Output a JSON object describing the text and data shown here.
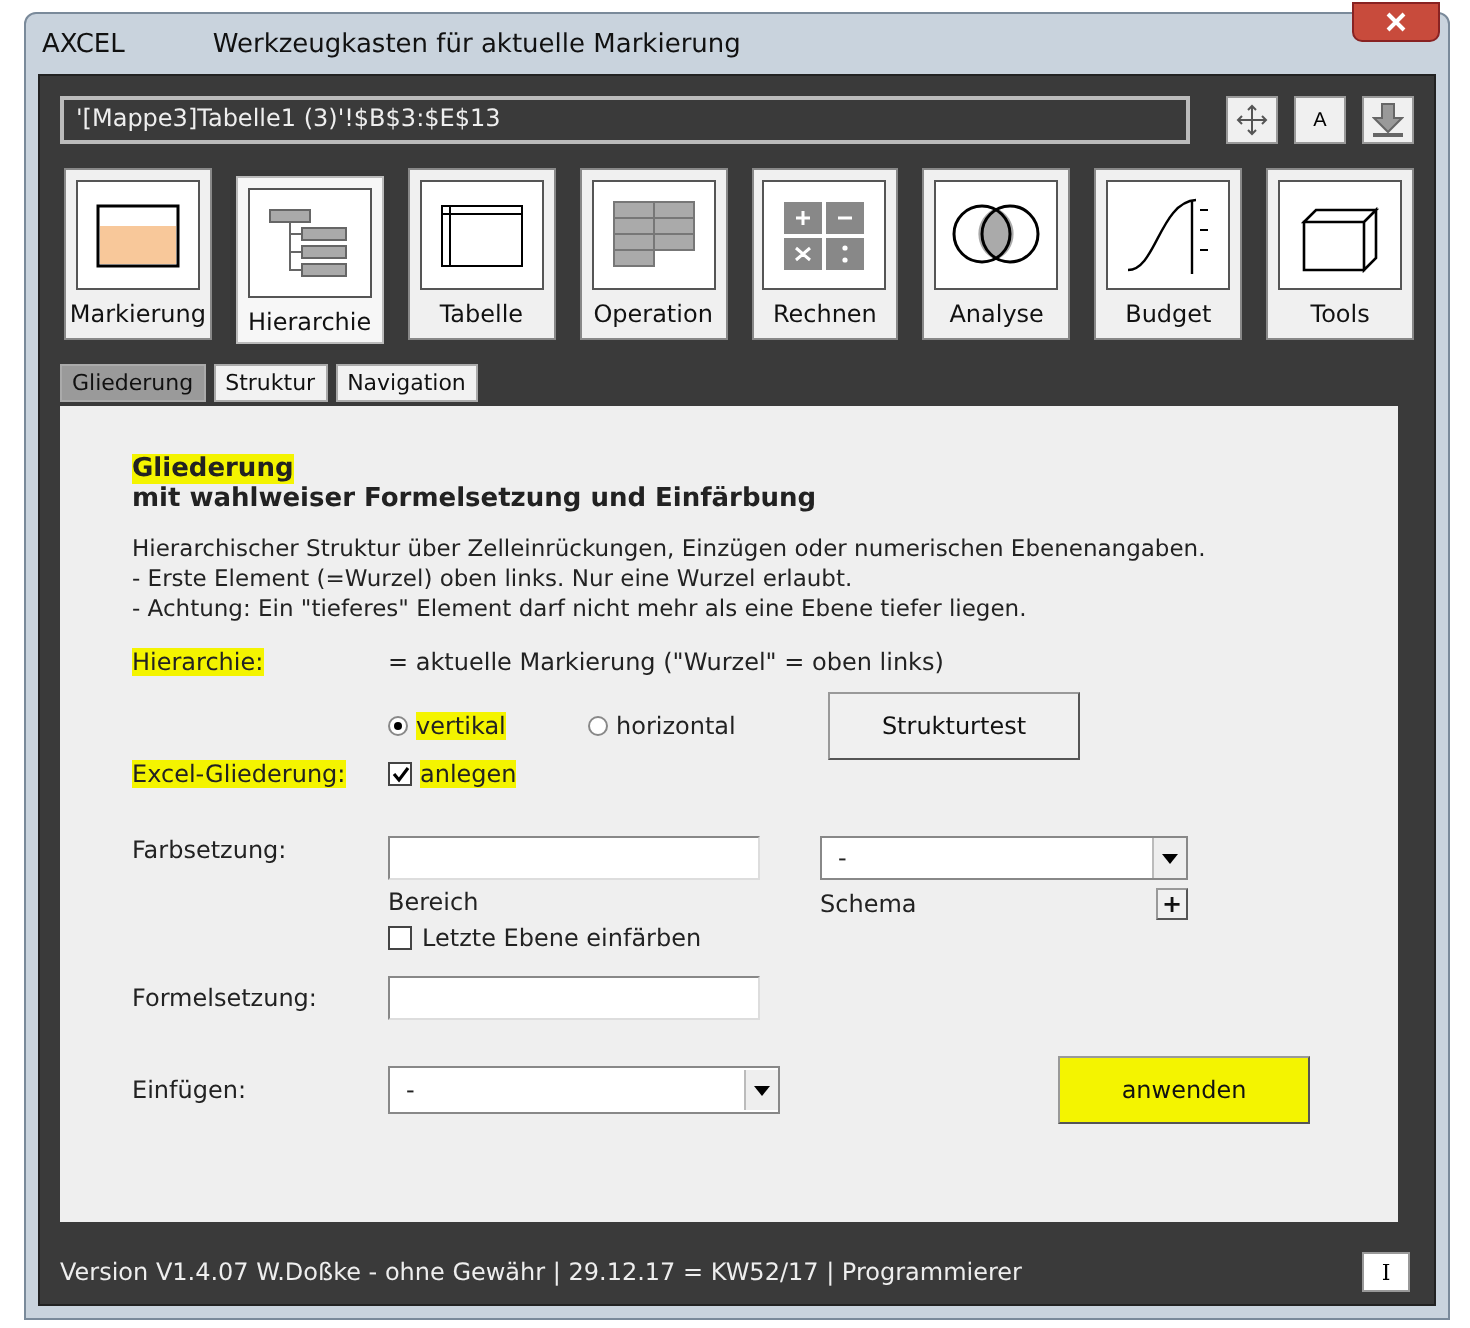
{
  "window": {
    "app": "AXCEL",
    "title": "Werkzeugkasten für aktuelle Markierung"
  },
  "range_field": {
    "value": "'[Mappe3]Tabelle1 (3)'!$B$3:$E$13"
  },
  "top_buttons": [
    {
      "kind": "move"
    },
    {
      "kind": "font",
      "label": "A"
    },
    {
      "kind": "download"
    }
  ],
  "toolbar": [
    {
      "label": "Markierung",
      "kind": "marking",
      "selected": false
    },
    {
      "label": "Hierarchie",
      "kind": "hierarchy",
      "selected": true
    },
    {
      "label": "Tabelle",
      "kind": "table",
      "selected": false
    },
    {
      "label": "Operation",
      "kind": "operation",
      "selected": false
    },
    {
      "label": "Rechnen",
      "kind": "calc",
      "selected": false
    },
    {
      "label": "Analyse",
      "kind": "venn",
      "selected": false
    },
    {
      "label": "Budget",
      "kind": "curve",
      "selected": false
    },
    {
      "label": "Tools",
      "kind": "box",
      "selected": false
    }
  ],
  "tabs": [
    {
      "label": "Gliederung",
      "selected": true
    },
    {
      "label": "Struktur",
      "selected": false
    },
    {
      "label": "Navigation",
      "selected": false
    }
  ],
  "panel": {
    "heading": "Gliederung",
    "heading_highlighted": true,
    "subheading": "mit wahlweiser Formelsetzung und Einfärbung",
    "description": [
      "Hierarchischer Struktur über Zelleinrückungen, Einzügen oder numerischen Ebenenangaben.",
      "- Erste Element (=Wurzel) oben links. Nur eine Wurzel erlaubt.",
      "- Achtung: Ein \"tieferes\" Element darf nicht mehr als eine Ebene tiefer liegen."
    ],
    "hierarchy": {
      "label": "Hierarchie:",
      "label_highlighted": true,
      "note": "= aktuelle Markierung (\"Wurzel\" = oben links)",
      "options": [
        {
          "label": "vertikal",
          "selected": true,
          "highlighted": true
        },
        {
          "label": "horizontal",
          "selected": false,
          "highlighted": false
        }
      ],
      "button": "Strukturtest"
    },
    "outline": {
      "label": "Excel-Gliederung:",
      "highlighted": true,
      "checkbox": {
        "label": "anlegen",
        "checked": true
      }
    },
    "coloring": {
      "label": "Farbsetzung:",
      "range_caption": "Bereich",
      "scheme_value": "-",
      "scheme_caption": "Schema",
      "add_button": "+",
      "checkbox": {
        "label": "Letzte Ebene einfärben",
        "checked": false
      }
    },
    "formula": {
      "label": "Formelsetzung:"
    },
    "insert": {
      "label": "Einfügen:",
      "value": "-"
    },
    "apply_button": {
      "label": "anwenden",
      "highlighted": true
    }
  },
  "status_bar": {
    "text": "Version V1.4.07 W.Doßke - ohne Gewähr | 29.12.17 = KW52/17 | Programmierer",
    "button": "I"
  }
}
